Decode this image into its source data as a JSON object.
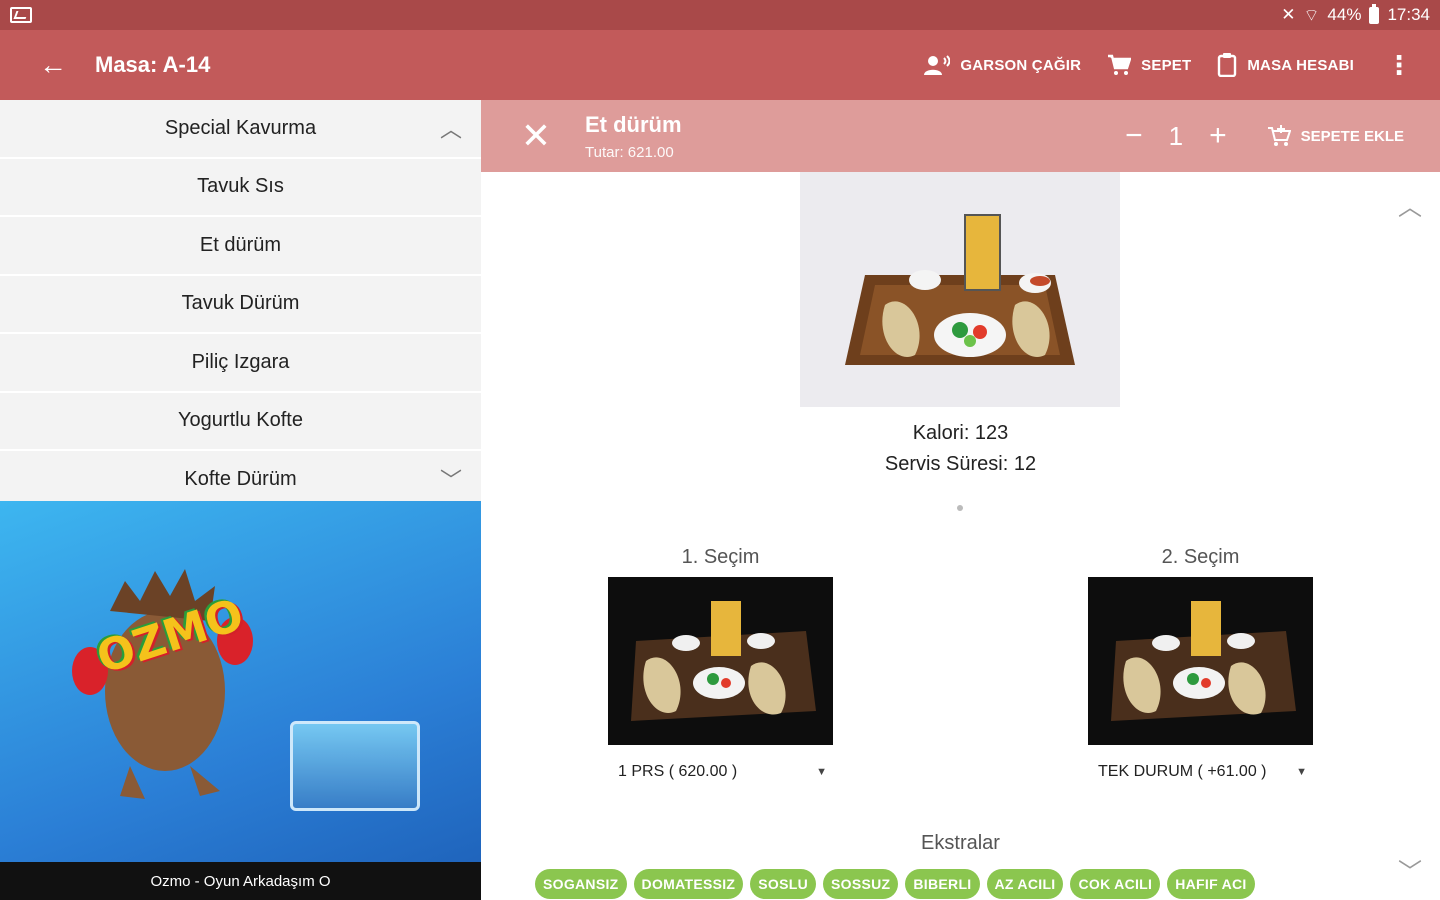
{
  "status_bar": {
    "battery": "44%",
    "time": "17:34"
  },
  "app_bar": {
    "title": "Masa: A-14",
    "actions": {
      "call_waiter": "GARSON ÇAĞIR",
      "cart": "SEPET",
      "table_bill": "MASA HESABI"
    }
  },
  "menu_list": {
    "items": [
      {
        "label": "Special Kavurma"
      },
      {
        "label": "Tavuk Sıs"
      },
      {
        "label": "Et dürüm"
      },
      {
        "label": "Tavuk Dürüm"
      },
      {
        "label": "Piliç Izgara"
      },
      {
        "label": "Yogurtlu Kofte"
      },
      {
        "label": "Kofte Dürüm"
      }
    ]
  },
  "ad": {
    "caption": "Ozmo - Oyun Arkadaşım O",
    "logo_text": "OZMO"
  },
  "product": {
    "name": "Et dürüm",
    "total": "Tutar: 621.00",
    "quantity": "1",
    "minus": "−",
    "plus": "+",
    "add_to_cart": "SEPETE EKLE",
    "calories": "Kalori: 123",
    "service_time": "Servis Süresi: 12"
  },
  "selections": [
    {
      "label": "1. Seçim",
      "value": "1 PRS ( 620.00 )"
    },
    {
      "label": "2. Seçim",
      "value": "TEK DURUM ( +61.00 )"
    }
  ],
  "extras": {
    "title": "Ekstralar",
    "chips": [
      "SOGANSIZ",
      "DOMATESSIZ",
      "SOSLU",
      "SOSSUZ",
      "BIBERLI",
      "AZ ACILI",
      "COK ACILI",
      "HAFIF ACI"
    ]
  },
  "colors": {
    "status_bar": "#a94949",
    "app_bar": "#c25a5a",
    "detail_bar": "#de9c9a",
    "chip": "#8bc64f"
  }
}
